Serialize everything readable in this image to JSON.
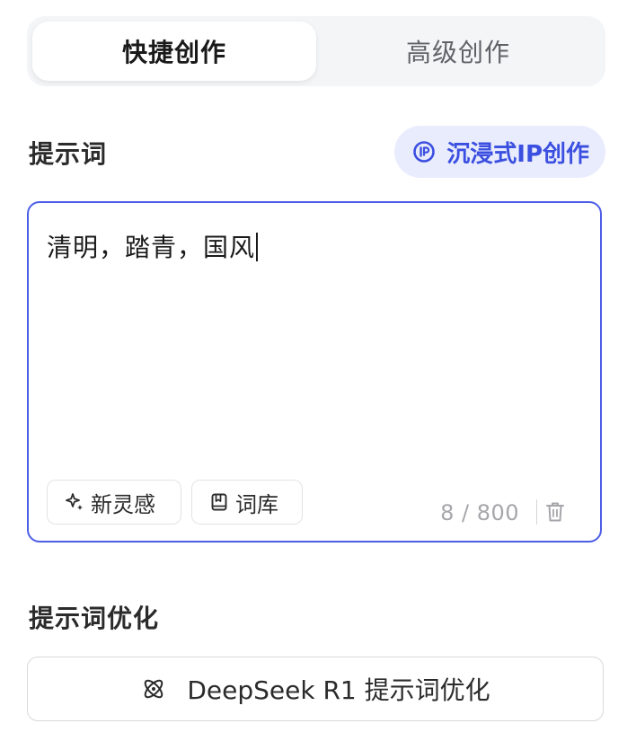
{
  "tabs": {
    "quick": "快捷创作",
    "advanced": "高级创作"
  },
  "prompt_section": {
    "title": "提示词",
    "ip_button_label": "沉浸式IP创作",
    "input_value": "清明，踏青，国风",
    "inspire_label": "新灵感",
    "lexicon_label": "词库",
    "counter": "8 / 800"
  },
  "optimize_section": {
    "title": "提示词优化",
    "button_label": "DeepSeek R1 提示词优化"
  },
  "colors": {
    "accent": "#3b4fe0",
    "accent_bg": "#e9ecfd",
    "focus_border": "#4d5ee6"
  },
  "icons": {
    "ip": "ip-circle-icon",
    "inspire": "sparkle-icon",
    "lexicon": "book-icon",
    "trash": "trash-icon",
    "optimize": "atom-icon"
  }
}
